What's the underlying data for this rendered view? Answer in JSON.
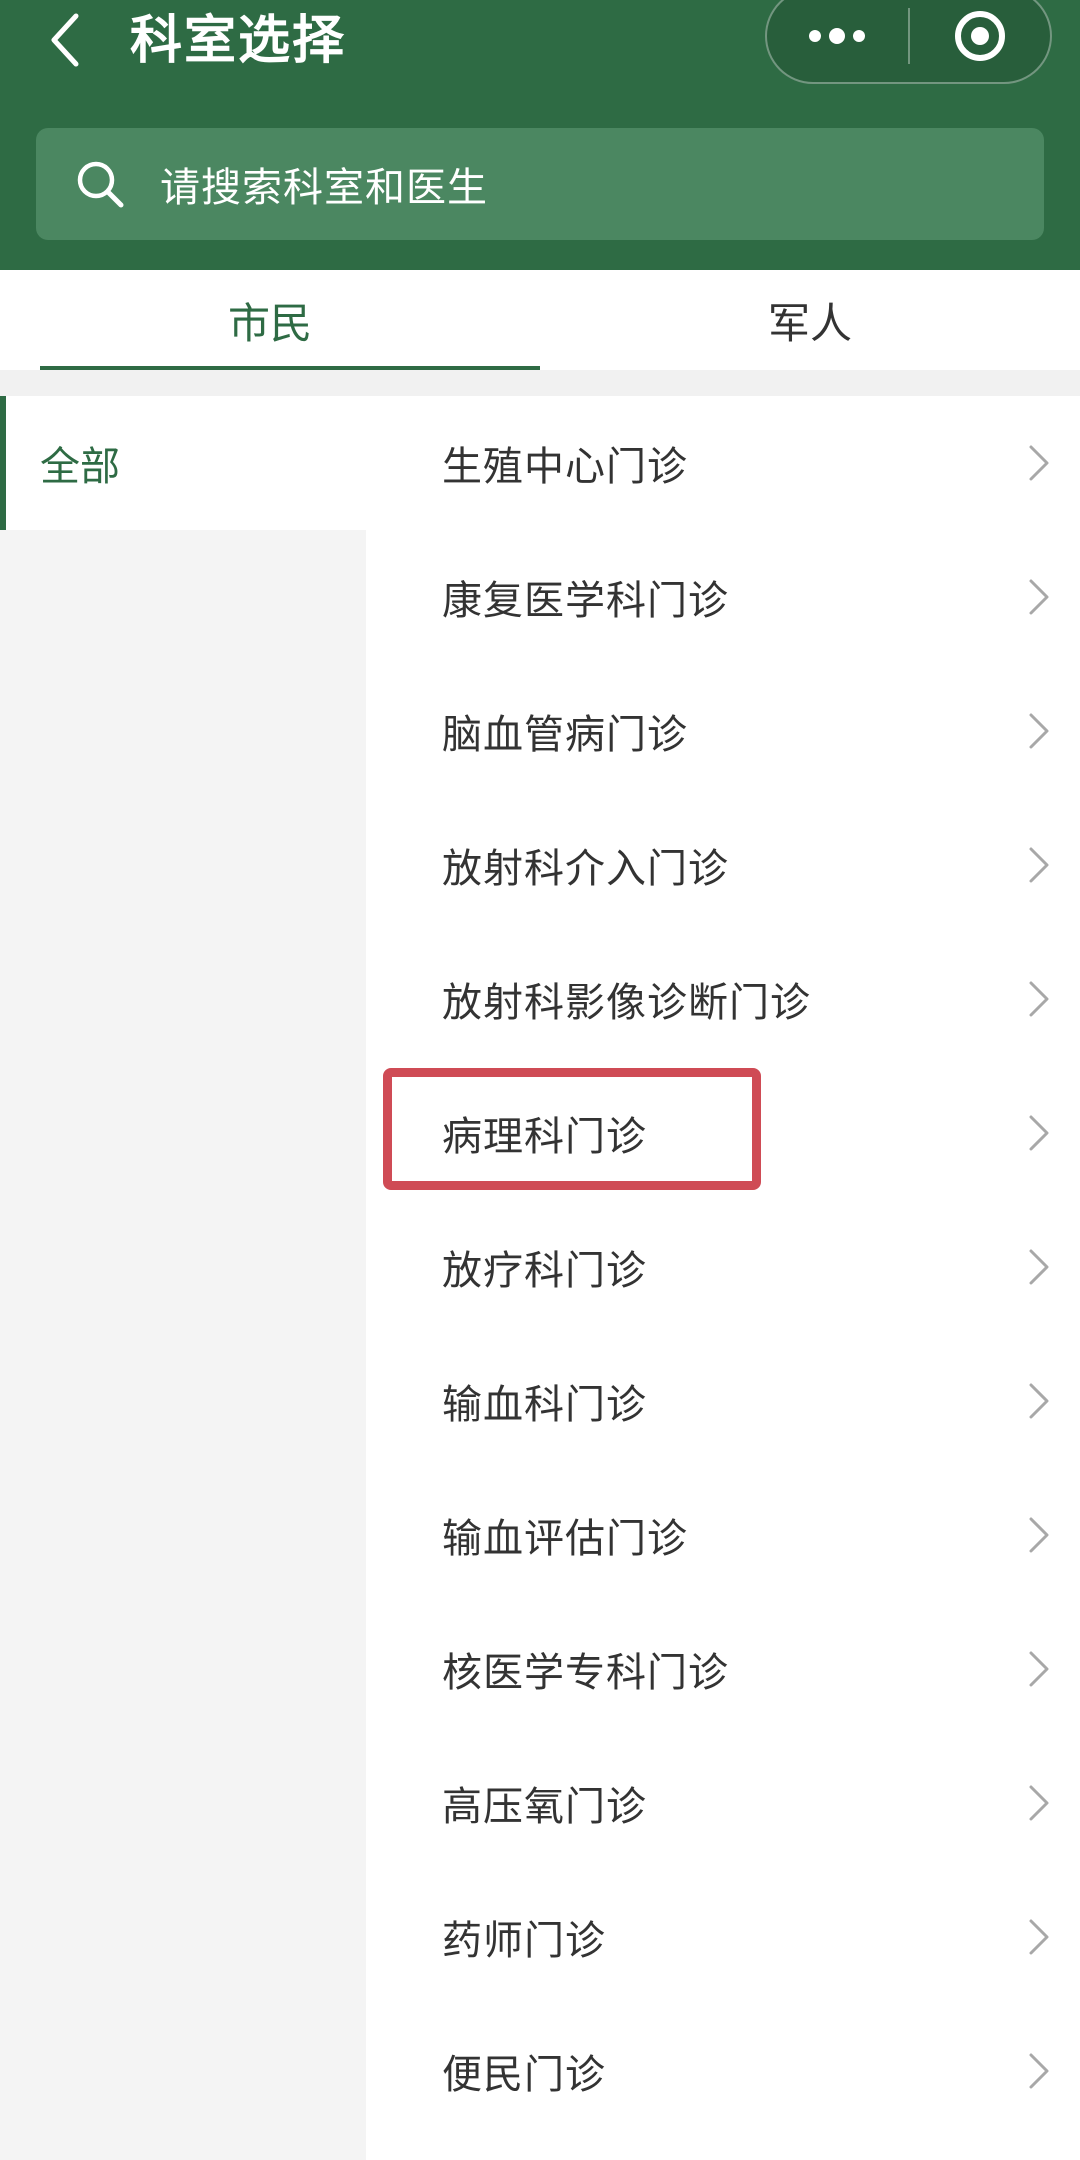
{
  "header": {
    "title": "科室选择",
    "back_icon": "chevron-left-icon",
    "more_icon": "more-dots-icon",
    "close_icon": "target-circle-icon",
    "background": "#2e6b44"
  },
  "search": {
    "placeholder": "请搜索科室和医生",
    "icon": "search-icon"
  },
  "tabs": [
    {
      "label": "市民",
      "active": true
    },
    {
      "label": "军人",
      "active": false
    }
  ],
  "sidebar": {
    "items": [
      {
        "label": "全部",
        "active": true
      }
    ]
  },
  "departments": [
    {
      "name": "生殖中心门诊"
    },
    {
      "name": "康复医学科门诊"
    },
    {
      "name": "脑血管病门诊"
    },
    {
      "name": "放射科介入门诊"
    },
    {
      "name": "放射科影像诊断门诊"
    },
    {
      "name": "病理科门诊",
      "highlighted": true
    },
    {
      "name": "放疗科门诊"
    },
    {
      "name": "输血科门诊"
    },
    {
      "name": "输血评估门诊"
    },
    {
      "name": "核医学专科门诊"
    },
    {
      "name": "高压氧门诊"
    },
    {
      "name": "药师门诊"
    },
    {
      "name": "便民门诊"
    }
  ],
  "colors": {
    "accent": "#2e6b44",
    "highlight": "#cf4b55"
  }
}
